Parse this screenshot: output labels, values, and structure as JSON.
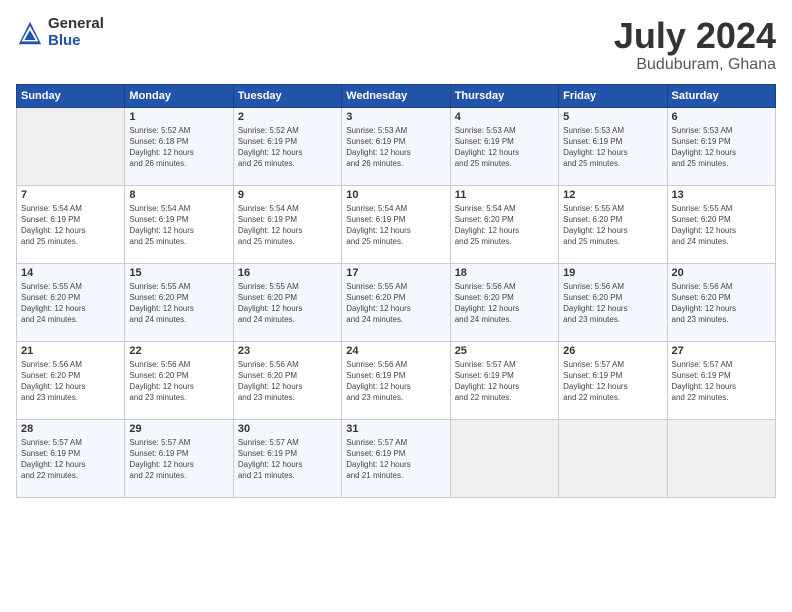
{
  "header": {
    "logo_general": "General",
    "logo_blue": "Blue",
    "title": "July 2024",
    "subtitle": "Buduburam, Ghana"
  },
  "days_of_week": [
    "Sunday",
    "Monday",
    "Tuesday",
    "Wednesday",
    "Thursday",
    "Friday",
    "Saturday"
  ],
  "weeks": [
    [
      {
        "day": "",
        "info": ""
      },
      {
        "day": "1",
        "info": "Sunrise: 5:52 AM\nSunset: 6:18 PM\nDaylight: 12 hours\nand 26 minutes."
      },
      {
        "day": "2",
        "info": "Sunrise: 5:52 AM\nSunset: 6:19 PM\nDaylight: 12 hours\nand 26 minutes."
      },
      {
        "day": "3",
        "info": "Sunrise: 5:53 AM\nSunset: 6:19 PM\nDaylight: 12 hours\nand 26 minutes."
      },
      {
        "day": "4",
        "info": "Sunrise: 5:53 AM\nSunset: 6:19 PM\nDaylight: 12 hours\nand 25 minutes."
      },
      {
        "day": "5",
        "info": "Sunrise: 5:53 AM\nSunset: 6:19 PM\nDaylight: 12 hours\nand 25 minutes."
      },
      {
        "day": "6",
        "info": "Sunrise: 5:53 AM\nSunset: 6:19 PM\nDaylight: 12 hours\nand 25 minutes."
      }
    ],
    [
      {
        "day": "7",
        "info": "Sunrise: 5:54 AM\nSunset: 6:19 PM\nDaylight: 12 hours\nand 25 minutes."
      },
      {
        "day": "8",
        "info": "Sunrise: 5:54 AM\nSunset: 6:19 PM\nDaylight: 12 hours\nand 25 minutes."
      },
      {
        "day": "9",
        "info": "Sunrise: 5:54 AM\nSunset: 6:19 PM\nDaylight: 12 hours\nand 25 minutes."
      },
      {
        "day": "10",
        "info": "Sunrise: 5:54 AM\nSunset: 6:19 PM\nDaylight: 12 hours\nand 25 minutes."
      },
      {
        "day": "11",
        "info": "Sunrise: 5:54 AM\nSunset: 6:20 PM\nDaylight: 12 hours\nand 25 minutes."
      },
      {
        "day": "12",
        "info": "Sunrise: 5:55 AM\nSunset: 6:20 PM\nDaylight: 12 hours\nand 25 minutes."
      },
      {
        "day": "13",
        "info": "Sunrise: 5:55 AM\nSunset: 6:20 PM\nDaylight: 12 hours\nand 24 minutes."
      }
    ],
    [
      {
        "day": "14",
        "info": "Sunrise: 5:55 AM\nSunset: 6:20 PM\nDaylight: 12 hours\nand 24 minutes."
      },
      {
        "day": "15",
        "info": "Sunrise: 5:55 AM\nSunset: 6:20 PM\nDaylight: 12 hours\nand 24 minutes."
      },
      {
        "day": "16",
        "info": "Sunrise: 5:55 AM\nSunset: 6:20 PM\nDaylight: 12 hours\nand 24 minutes."
      },
      {
        "day": "17",
        "info": "Sunrise: 5:55 AM\nSunset: 6:20 PM\nDaylight: 12 hours\nand 24 minutes."
      },
      {
        "day": "18",
        "info": "Sunrise: 5:56 AM\nSunset: 6:20 PM\nDaylight: 12 hours\nand 24 minutes."
      },
      {
        "day": "19",
        "info": "Sunrise: 5:56 AM\nSunset: 6:20 PM\nDaylight: 12 hours\nand 23 minutes."
      },
      {
        "day": "20",
        "info": "Sunrise: 5:56 AM\nSunset: 6:20 PM\nDaylight: 12 hours\nand 23 minutes."
      }
    ],
    [
      {
        "day": "21",
        "info": "Sunrise: 5:56 AM\nSunset: 6:20 PM\nDaylight: 12 hours\nand 23 minutes."
      },
      {
        "day": "22",
        "info": "Sunrise: 5:56 AM\nSunset: 6:20 PM\nDaylight: 12 hours\nand 23 minutes."
      },
      {
        "day": "23",
        "info": "Sunrise: 5:56 AM\nSunset: 6:20 PM\nDaylight: 12 hours\nand 23 minutes."
      },
      {
        "day": "24",
        "info": "Sunrise: 5:56 AM\nSunset: 6:19 PM\nDaylight: 12 hours\nand 23 minutes."
      },
      {
        "day": "25",
        "info": "Sunrise: 5:57 AM\nSunset: 6:19 PM\nDaylight: 12 hours\nand 22 minutes."
      },
      {
        "day": "26",
        "info": "Sunrise: 5:57 AM\nSunset: 6:19 PM\nDaylight: 12 hours\nand 22 minutes."
      },
      {
        "day": "27",
        "info": "Sunrise: 5:57 AM\nSunset: 6:19 PM\nDaylight: 12 hours\nand 22 minutes."
      }
    ],
    [
      {
        "day": "28",
        "info": "Sunrise: 5:57 AM\nSunset: 6:19 PM\nDaylight: 12 hours\nand 22 minutes."
      },
      {
        "day": "29",
        "info": "Sunrise: 5:57 AM\nSunset: 6:19 PM\nDaylight: 12 hours\nand 22 minutes."
      },
      {
        "day": "30",
        "info": "Sunrise: 5:57 AM\nSunset: 6:19 PM\nDaylight: 12 hours\nand 21 minutes."
      },
      {
        "day": "31",
        "info": "Sunrise: 5:57 AM\nSunset: 6:19 PM\nDaylight: 12 hours\nand 21 minutes."
      },
      {
        "day": "",
        "info": ""
      },
      {
        "day": "",
        "info": ""
      },
      {
        "day": "",
        "info": ""
      }
    ]
  ]
}
